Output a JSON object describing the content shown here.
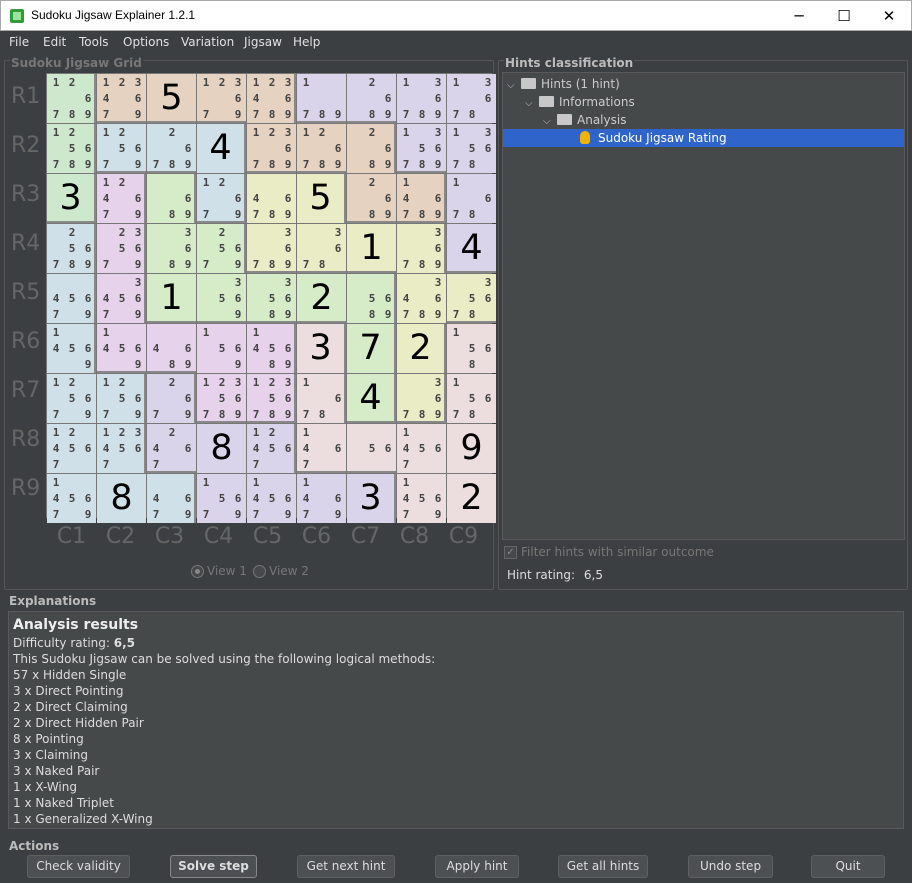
{
  "window": {
    "title": "Sudoku Jigsaw Explainer 1.2.1",
    "minimize": "─",
    "maximize": "☐",
    "close": "✕"
  },
  "menu": [
    "File",
    "Edit",
    "Tools",
    "Options",
    "Variation",
    "Jigsaw",
    "Help"
  ],
  "grid_panel": {
    "title": "Sudoku Jigsaw Grid"
  },
  "row_labels": [
    "R1",
    "R2",
    "R3",
    "R4",
    "R5",
    "R6",
    "R7",
    "R8",
    "R9"
  ],
  "col_labels": [
    "C1",
    "C2",
    "C3",
    "C4",
    "C5",
    "C6",
    "C7",
    "C8",
    "C9"
  ],
  "region_colors": [
    "#cde8cd",
    "#e5d2c0",
    "#e6d2ea",
    "#cfe0e9",
    "#d9d4ea",
    "#e8dfd4",
    "#d6ecc8",
    "#ecdede",
    "#e9ecc4"
  ],
  "grid": [
    [
      {
        "c": "12 6789"
      },
      {
        "c": "123 467 9"
      },
      {
        "v": "5"
      },
      {
        "c": "123 6 7 9"
      },
      {
        "c": "123 46 789"
      },
      {
        "c": "1 789"
      },
      {
        "c": "2 6 89"
      },
      {
        "c": "1 3 6 789"
      },
      {
        "c": "1 3 6 7 8"
      }
    ],
    [
      {
        "c": "12 56 789"
      },
      {
        "c": "12 56 7 9"
      },
      {
        "c": "2 6 789"
      },
      {
        "v": "4"
      },
      {
        "c": "123 6 789"
      },
      {
        "c": "12 6 789"
      },
      {
        "c": "2 6 89"
      },
      {
        "c": "1 3 56 789"
      },
      {
        "c": "1 3 56 78"
      }
    ],
    [
      {
        "v": "3"
      },
      {
        "c": "12 4 6 7 9"
      },
      {
        "c": "6 89"
      },
      {
        "c": "12 6 7 9"
      },
      {
        "c": "4 6 789"
      },
      {
        "v": "5"
      },
      {
        "c": "2 6 89"
      },
      {
        "c": "1 4 6 789"
      },
      {
        "c": "1 6 78"
      }
    ],
    [
      {
        "c": "2 56 789"
      },
      {
        "c": "23 56 7 9"
      },
      {
        "c": "3 6 89"
      },
      {
        "c": "2 56 7 9"
      },
      {
        "c": "3 6 789"
      },
      {
        "c": "3 6 78"
      },
      {
        "v": "1"
      },
      {
        "c": "3 6 789"
      },
      {
        "v": "4"
      }
    ],
    [
      {
        "c": "456 7 9"
      },
      {
        "c": "3 456 7 9"
      },
      {
        "v": "1"
      },
      {
        "c": "3 56 9"
      },
      {
        "c": "3 56 89"
      },
      {
        "v": "2"
      },
      {
        "c": "56 89"
      },
      {
        "c": "3 4 6 789"
      },
      {
        "c": "3 56 78"
      }
    ],
    [
      {
        "c": "1 456 9"
      },
      {
        "c": "1 456 9"
      },
      {
        "c": "4 6 89"
      },
      {
        "c": "1 56 9"
      },
      {
        "c": "1 456 89"
      },
      {
        "v": "3"
      },
      {
        "v": "7"
      },
      {
        "v": "2"
      },
      {
        "c": "1 56 8"
      }
    ],
    [
      {
        "c": "12 56 7 9"
      },
      {
        "c": "12 56 7 9"
      },
      {
        "c": "2 6 7 9"
      },
      {
        "c": "123 56 789"
      },
      {
        "c": "123 56 789"
      },
      {
        "c": "1 6 78"
      },
      {
        "v": "4"
      },
      {
        "c": "3 6 789"
      },
      {
        "c": "1 56 78"
      }
    ],
    [
      {
        "c": "12 456 7"
      },
      {
        "c": "123 456 7"
      },
      {
        "c": "2 4 6 7"
      },
      {
        "v": "8"
      },
      {
        "c": "12 456 7"
      },
      {
        "c": "1 4 6 7"
      },
      {
        "c": "56"
      },
      {
        "c": "1 456 7"
      },
      {
        "v": "9"
      }
    ],
    [
      {
        "c": "1 456 7 9"
      },
      {
        "v": "8"
      },
      {
        "c": "4 6 7 9"
      },
      {
        "c": "1 56 7 9"
      },
      {
        "c": "1 456 7 9"
      },
      {
        "c": "1 4 6 7 9"
      },
      {
        "v": "3"
      },
      {
        "c": "1 456 7 9"
      },
      {
        "v": "2"
      }
    ]
  ],
  "region_map": [
    [
      0,
      1,
      1,
      1,
      1,
      4,
      4,
      4,
      4
    ],
    [
      0,
      3,
      3,
      3,
      1,
      1,
      1,
      4,
      4
    ],
    [
      0,
      2,
      6,
      3,
      8,
      8,
      1,
      1,
      4
    ],
    [
      3,
      2,
      6,
      6,
      8,
      8,
      8,
      8,
      4
    ],
    [
      3,
      2,
      6,
      6,
      6,
      6,
      6,
      8,
      8
    ],
    [
      3,
      2,
      2,
      2,
      2,
      7,
      6,
      8,
      7
    ],
    [
      3,
      3,
      4,
      2,
      2,
      7,
      6,
      8,
      7
    ],
    [
      3,
      3,
      4,
      4,
      4,
      7,
      7,
      7,
      7
    ],
    [
      3,
      3,
      3,
      4,
      4,
      4,
      4,
      7,
      7
    ]
  ],
  "views": {
    "view1": "View 1",
    "view2": "View 2"
  },
  "hints_panel": {
    "title": "Hints classification",
    "tree": [
      {
        "label": "Hints (1 hint)",
        "level": 0,
        "type": "folder"
      },
      {
        "label": "Informations",
        "level": 1,
        "type": "folder"
      },
      {
        "label": "Analysis",
        "level": 2,
        "type": "folder"
      },
      {
        "label": "Sudoku Jigsaw Rating",
        "level": 3,
        "type": "hint"
      }
    ],
    "filter_label": "Filter hints with similar outcome",
    "rating_label": "Hint rating:",
    "rating_value": "6,5"
  },
  "explanations": {
    "title": "Explanations",
    "heading": "Analysis results",
    "difficulty_label": "Difficulty rating: ",
    "difficulty_value": "6,5",
    "intro": "This Sudoku Jigsaw can be solved using the following logical methods:",
    "methods": [
      "57 x Hidden Single",
      "3 x Direct Pointing",
      "2 x Direct Claiming",
      "2 x Direct Hidden Pair",
      "8 x Pointing",
      "3 x Claiming",
      "3 x Naked Pair",
      "1 x X-Wing",
      "1 x Naked Triplet",
      "1 x Generalized X-Wing"
    ]
  },
  "actions": {
    "title": "Actions",
    "buttons": [
      "Check validity",
      "Solve step",
      "Get next hint",
      "Apply hint",
      "Get all hints",
      "Undo step",
      "Quit"
    ]
  }
}
